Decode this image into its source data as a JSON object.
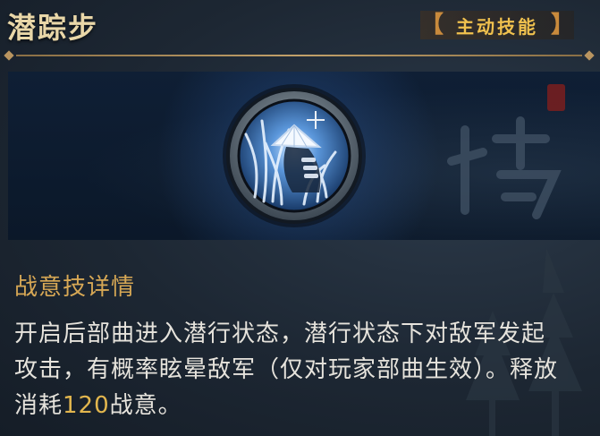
{
  "skill": {
    "name": "潜踪步",
    "type_label": "主动技能",
    "bracket_left": "【",
    "bracket_right": "】"
  },
  "icon": {
    "name": "straw-hat-warrior-in-grass-icon"
  },
  "details": {
    "heading": "战意技详情",
    "description_part1": "开启后部曲进入潜行状态，潜行状态下对敌军发起攻击，有概率眩晕敌军（仅对玩家部曲生效）。释放消耗",
    "cost": "120",
    "description_part2": "战意。"
  },
  "colors": {
    "title": "#e9d7a8",
    "tag_text": "#f0c14e",
    "heading": "#d7a855",
    "highlight": "#e2b64e",
    "body_text": "#e6e3dc"
  }
}
